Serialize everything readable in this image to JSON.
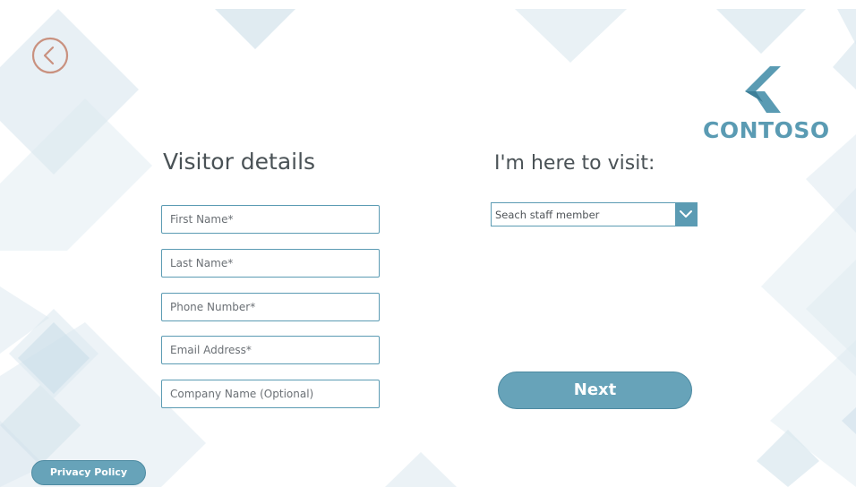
{
  "header": {
    "back_icon": "chevron-left-circle-icon",
    "logo_text": "CONTOSO"
  },
  "visitor_form": {
    "title": "Visitor details",
    "fields": [
      {
        "placeholder": "First Name*",
        "value": ""
      },
      {
        "placeholder": "Last Name*",
        "value": ""
      },
      {
        "placeholder": "Phone Number*",
        "value": ""
      },
      {
        "placeholder": "Email Address*",
        "value": ""
      },
      {
        "placeholder": "Company Name (Optional)",
        "value": ""
      }
    ]
  },
  "visit": {
    "title": "I'm here to visit:",
    "staff_dropdown": {
      "placeholder": "Seach staff member",
      "icon": "chevron-down-icon"
    }
  },
  "actions": {
    "next_label": "Next",
    "privacy_label": "Privacy Policy"
  },
  "colors": {
    "accent": "#5b9bb3",
    "button_fill": "#67a3b9",
    "back_icon": "#c9917f",
    "heading_text": "#4a5256",
    "background_shapes": "#dde9f0"
  }
}
